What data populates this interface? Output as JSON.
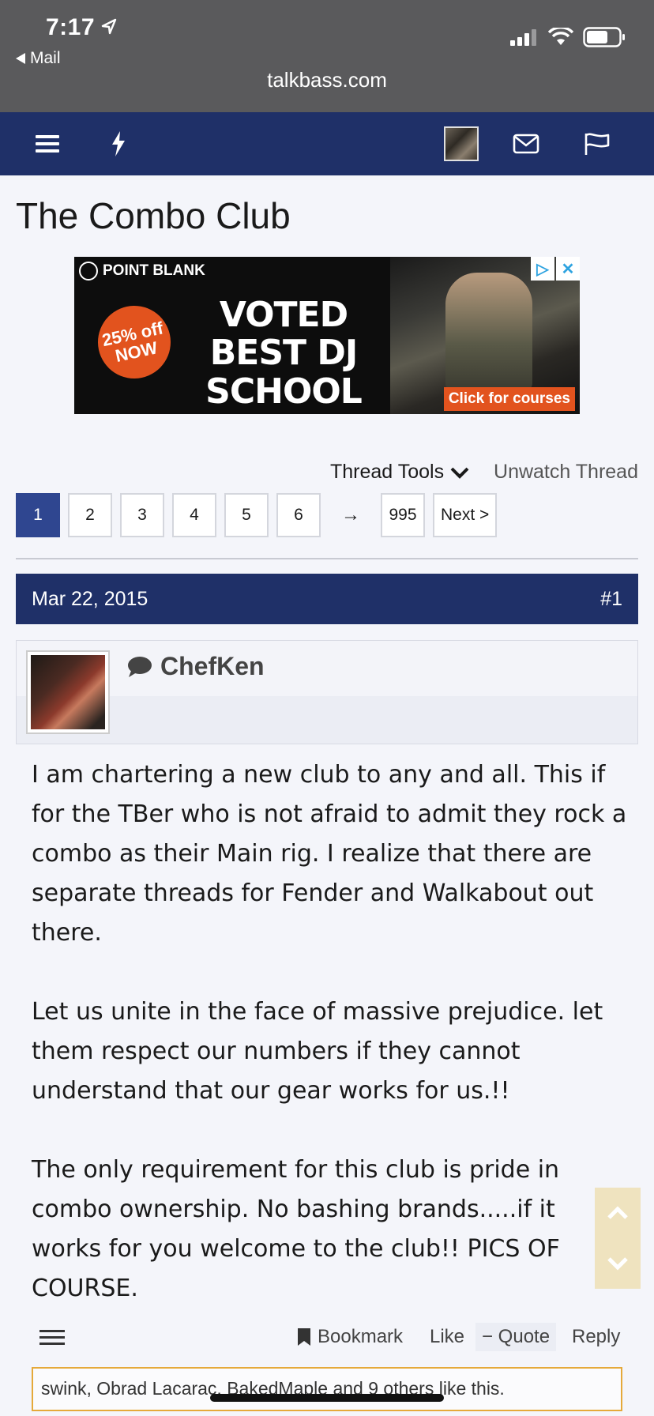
{
  "status_bar": {
    "time": "7:17",
    "back_label": "Mail",
    "url": "talkbass.com"
  },
  "page": {
    "title": "The Combo Club"
  },
  "ad": {
    "brand": "POINT BLANK",
    "badge": "25% off NOW",
    "headline": "VOTED BEST DJ SCHOOL",
    "cta": "Click for courses",
    "accent_color": "#e2531e"
  },
  "thread_tools": {
    "tools_label": "Thread Tools",
    "unwatch_label": "Unwatch Thread"
  },
  "pagination": {
    "pages": [
      "1",
      "2",
      "3",
      "4",
      "5",
      "6"
    ],
    "arrow": "→",
    "last": "995",
    "next": "Next >",
    "current": "1"
  },
  "post": {
    "date": "Mar 22, 2015",
    "number": "#1",
    "username": "ChefKen",
    "paragraphs": [
      "I am chartering a new club to any and all. This if for the TBer who is not afraid to admit they rock a combo as their Main rig. I realize that there are separate threads for Fender and Walkabout out there.",
      "Let us unite in the face of massive prejudice. let them respect our numbers if they cannot understand that our gear works for us.!!",
      "The only requirement for this club is pride in combo ownership. No bashing brands.....if it works for you welcome to the club!! PICS OF COURSE."
    ],
    "actions": {
      "bookmark": "Bookmark",
      "like": "Like",
      "quote": "− Quote",
      "reply": "Reply"
    },
    "likes": {
      "names": "swink, Obrad Lacarac, BakedMaple",
      "and": "and",
      "others": "9 others",
      "suffix": "like this."
    }
  },
  "colors": {
    "nav_bg": "#1f3068",
    "active_page": "#2f4690",
    "chrome_bg": "#5a5a5c"
  }
}
